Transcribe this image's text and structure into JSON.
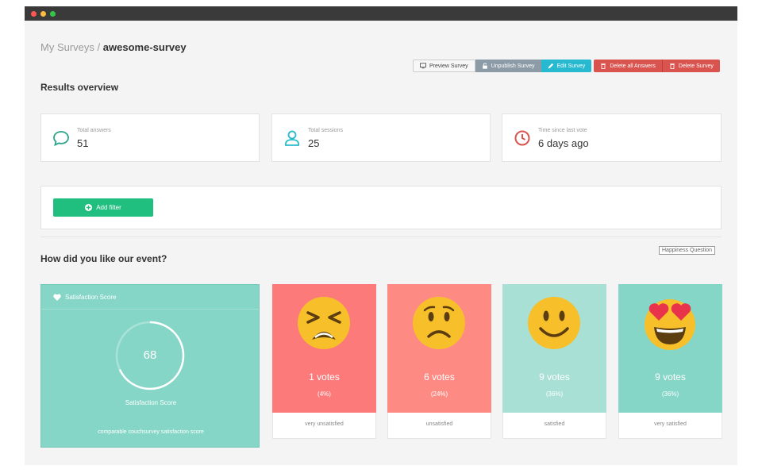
{
  "breadcrumb": {
    "parent": "My Surveys",
    "separator": "/",
    "current": "awesome-survey"
  },
  "toolbar": {
    "preview": "Preview Survey",
    "unpublish": "Unpublish Survey",
    "edit": "Edit Survey",
    "delete_answers": "Delete all Answers",
    "delete_survey": "Delete Survey"
  },
  "overview": {
    "title": "Results overview",
    "stats": [
      {
        "label": "Total answers",
        "value": "51",
        "icon": "chat-icon",
        "color": "#2aa58b"
      },
      {
        "label": "Total sessions",
        "value": "25",
        "icon": "user-icon",
        "color": "#27b9cf"
      },
      {
        "label": "Time since last vote",
        "value": "6 days ago",
        "icon": "clock-icon",
        "color": "#d9534f"
      }
    ]
  },
  "filter": {
    "button": "Add filter",
    "icon": "plus-circle-icon"
  },
  "question": {
    "title": "How did you like our event?",
    "type_badge": "Happiness Question",
    "score": {
      "header": "Satisfaction Score",
      "value": "68",
      "percent": 68,
      "label": "Satisfaction Score",
      "footnote": "comparable couchsurvey satisfaction score"
    },
    "moods": [
      {
        "votes": "1 votes",
        "pct": "(4%)",
        "label": "very unsatisfied",
        "color": "#fc7a7a",
        "icon": "tired-face-icon"
      },
      {
        "votes": "6 votes",
        "pct": "(24%)",
        "label": "unsatisfied",
        "color": "#fd8b84",
        "icon": "frowning-face-icon"
      },
      {
        "votes": "9 votes",
        "pct": "(36%)",
        "label": "satisfied",
        "color": "#a8e0d5",
        "icon": "smiling-face-icon"
      },
      {
        "votes": "9 votes",
        "pct": "(36%)",
        "label": "very satisfied",
        "color": "#85d6c7",
        "icon": "heart-eyes-face-icon"
      }
    ]
  }
}
